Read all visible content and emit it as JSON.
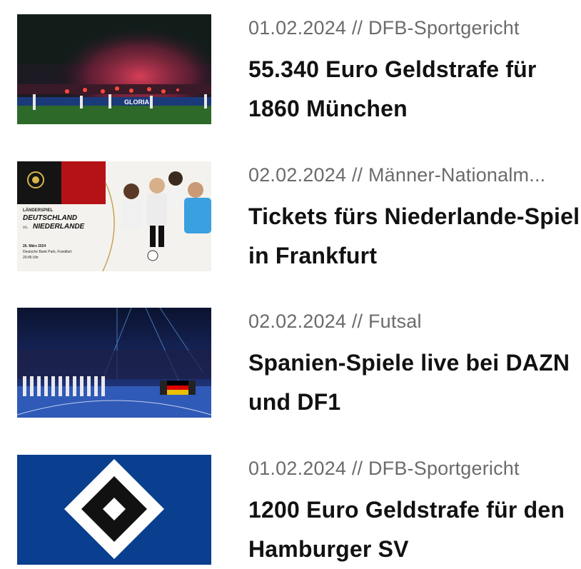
{
  "news": [
    {
      "date": "01.02.2024",
      "separator": "//",
      "category": "DFB-Sportgericht",
      "title": "55.340 Euro Geldstrafe für 1860 München",
      "image_banner": "GLORIA"
    },
    {
      "date": "02.02.2024",
      "separator": "//",
      "category": "Männer-Nationalm...",
      "title": "Tickets fürs Niederlande-Spiel in Frankfurt",
      "image_text": {
        "kicker": "LÄNDERSPIEL",
        "team1": "DEUTSCHLAND",
        "vs": "vs.",
        "team2": "NIEDERLANDE",
        "date": "26. März 2024",
        "venue": "Deutsche Bank Park, Frankfurt",
        "time": "20:45 Uhr"
      }
    },
    {
      "date": "02.02.2024",
      "separator": "//",
      "category": "Futsal",
      "title": "Spanien-Spiele live bei DAZN und DF1"
    },
    {
      "date": "01.02.2024",
      "separator": "//",
      "category": "DFB-Sportgericht",
      "title": "1200 Euro Geldstrafe für den Hamburger SV"
    }
  ],
  "colors": {
    "meta_text": "#6b6b6b",
    "title_text": "#111111",
    "hsv_blue": "#0a3f8f"
  }
}
